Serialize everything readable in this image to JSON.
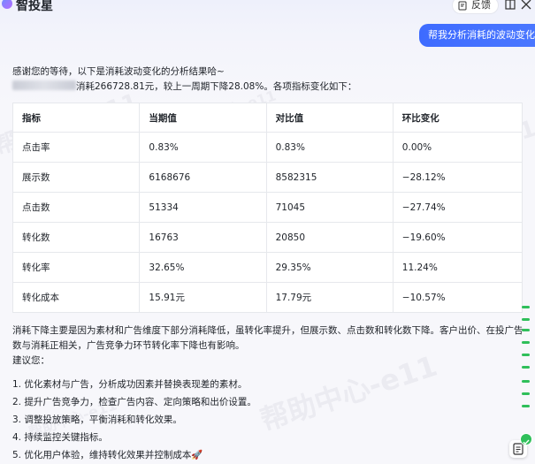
{
  "header": {
    "app_title": "智投星",
    "feedback_label": "反馈"
  },
  "user_message": "帮我分析消耗的波动变化",
  "answer": {
    "greeting": "感谢您的等待，以下是消耗波动变化的分析结果哈~",
    "summary": "消耗266728.81元，较上一周期下降28.08%。各项指标变化如下："
  },
  "table": {
    "headers": [
      "指标",
      "当期值",
      "对比值",
      "环比变化"
    ],
    "rows": [
      [
        "点击率",
        "0.83%",
        "0.83%",
        "0.00%"
      ],
      [
        "展示数",
        "6168676",
        "8582315",
        "−28.12%"
      ],
      [
        "点击数",
        "51334",
        "71045",
        "−27.74%"
      ],
      [
        "转化数",
        "16763",
        "20850",
        "−19.60%"
      ],
      [
        "转化率",
        "32.65%",
        "29.35%",
        "11.24%"
      ],
      [
        "转化成本",
        "15.91元",
        "17.79元",
        "−10.57%"
      ]
    ]
  },
  "analysis": {
    "paragraph": "消耗下降主要是因为素材和广告维度下部分消耗降低，虽转化率提升，但展示数、点击数和转化数下降。客户出价、在投广告数与消耗正相关，广告竞争力环节转化率下降也有影响。",
    "advice_title": "建议您：",
    "steps": [
      "1. 优化素材与广告，分析成功因素并替换表现差的素材。",
      "2. 提升广告竞争力，检查广告内容、定向策略和出价设置。",
      "3. 调整投放策略，平衡消耗和转化效果。",
      "4. 持续监控关键指标。",
      "5. 优化用户体验，维持转化效果并控制成本🚀"
    ]
  },
  "watermark": {
    "text": "帮助中心-e11",
    "small_text": "帮助中心"
  },
  "icons": [
    "logo-icon",
    "feedback-icon",
    "split-window-icon",
    "close-icon",
    "notes-icon",
    "check-icon"
  ],
  "colors": {
    "accent": "#3e6bff",
    "status_green": "#2fbf5a"
  }
}
